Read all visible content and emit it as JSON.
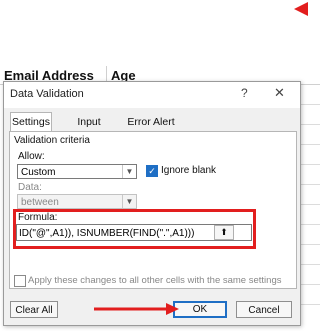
{
  "sheet": {
    "col1": "Email Address",
    "col2": "Age"
  },
  "dialog": {
    "title": "Data Validation",
    "help_glyph": "?",
    "close_glyph": "✕",
    "tabs": [
      {
        "label": "Settings"
      },
      {
        "label": "Input Message"
      },
      {
        "label": "Error Alert"
      }
    ],
    "section_label": "Validation criteria",
    "allow_label": "Allow:",
    "allow_value": "Custom",
    "ignore_blank_label": "Ignore blank",
    "data_label": "Data:",
    "data_value": "between",
    "formula_label": "Formula:",
    "formula_value": "ID(\"@\",A1)), ISNUMBER(FIND(\".\",A1)))",
    "ref_glyph": "⬆",
    "apply_label": "Apply these changes to all other cells with the same settings",
    "clear_all": "Clear All",
    "ok": "OK",
    "cancel": "Cancel"
  },
  "accent_color": "#e21e1e",
  "check_color": "#1f6fc5"
}
